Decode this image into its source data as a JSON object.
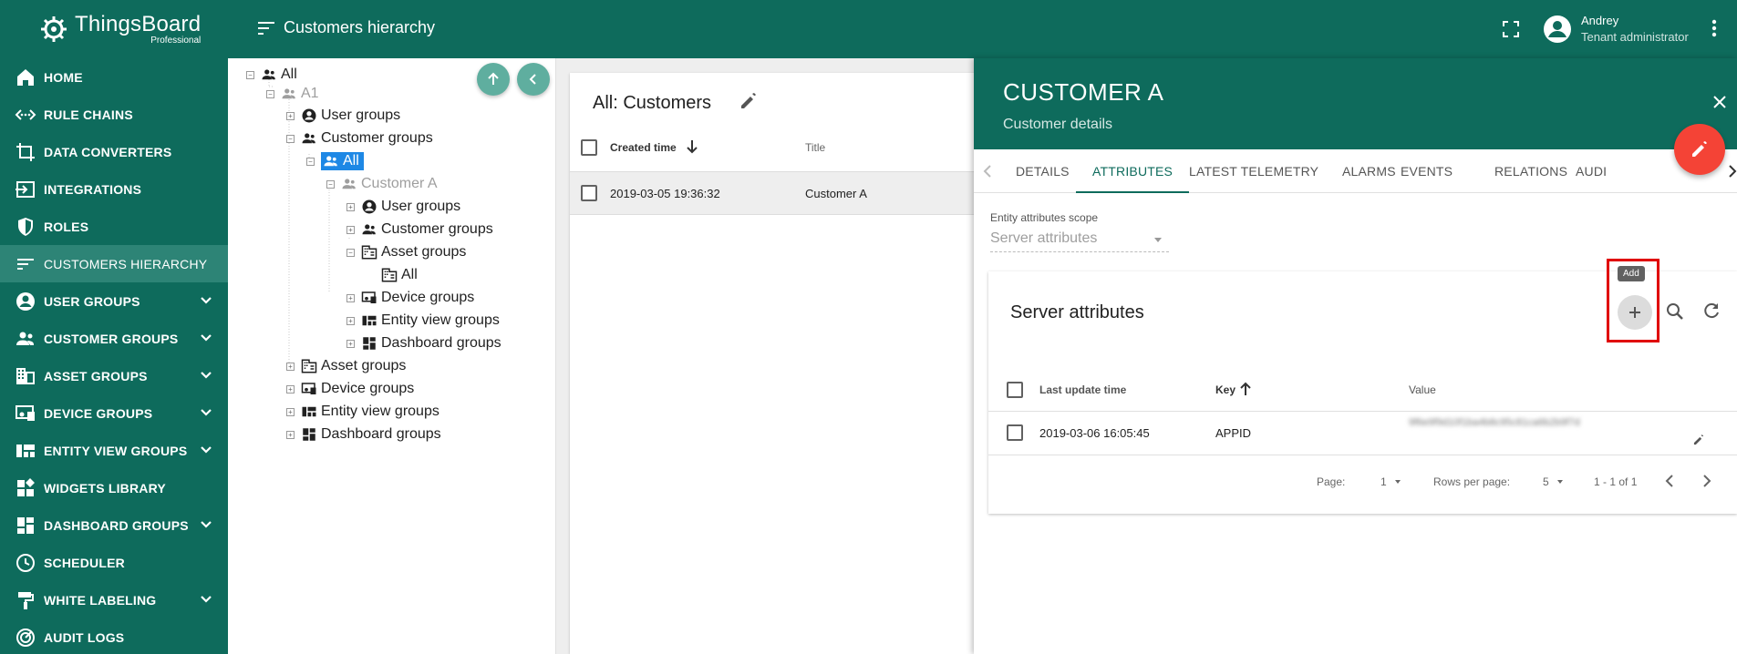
{
  "brand": {
    "name": "ThingsBoard",
    "edition": "Professional"
  },
  "colors": {
    "primary": "#0e6b5c",
    "accent": "#f44336",
    "selection": "#1e88e5",
    "highlight": "#e00000"
  },
  "sidebar": {
    "items": [
      {
        "label": "HOME",
        "icon": "home-icon"
      },
      {
        "label": "RULE CHAINS",
        "icon": "settings-ethernet-icon"
      },
      {
        "label": "DATA CONVERTERS",
        "icon": "transform-icon"
      },
      {
        "label": "INTEGRATIONS",
        "icon": "input-icon"
      },
      {
        "label": "ROLES",
        "icon": "security-icon"
      },
      {
        "label": "CUSTOMERS HIERARCHY",
        "icon": "sort-icon",
        "active": true
      },
      {
        "label": "USER GROUPS",
        "icon": "account-circle-icon",
        "expandable": true
      },
      {
        "label": "CUSTOMER GROUPS",
        "icon": "supervisor-account-icon",
        "expandable": true
      },
      {
        "label": "ASSET GROUPS",
        "icon": "domain-icon",
        "expandable": true
      },
      {
        "label": "DEVICE GROUPS",
        "icon": "devices-other-icon",
        "expandable": true
      },
      {
        "label": "ENTITY VIEW GROUPS",
        "icon": "view-quilt-icon",
        "expandable": true
      },
      {
        "label": "WIDGETS LIBRARY",
        "icon": "widgets-icon"
      },
      {
        "label": "DASHBOARD GROUPS",
        "icon": "dashboard-icon",
        "expandable": true
      },
      {
        "label": "SCHEDULER",
        "icon": "schedule-icon"
      },
      {
        "label": "WHITE LABELING",
        "icon": "format-paint-icon",
        "expandable": true
      },
      {
        "label": "AUDIT LOGS",
        "icon": "track-changes-icon"
      }
    ]
  },
  "topbar": {
    "title": "Customers hierarchy",
    "user_name": "Andrey",
    "user_role": "Tenant administrator"
  },
  "tree": {
    "nodes": [
      {
        "label": "All"
      },
      {
        "label": "A1"
      },
      {
        "label": "User groups"
      },
      {
        "label": "Customer groups"
      },
      {
        "label": "All"
      },
      {
        "label": "Customer A"
      },
      {
        "label": "User groups"
      },
      {
        "label": "Customer groups"
      },
      {
        "label": "Asset groups"
      },
      {
        "label": "All"
      },
      {
        "label": "Device groups"
      },
      {
        "label": "Entity view groups"
      },
      {
        "label": "Dashboard groups"
      },
      {
        "label": "Asset groups"
      },
      {
        "label": "Device groups"
      },
      {
        "label": "Entity view groups"
      },
      {
        "label": "Dashboard groups"
      }
    ]
  },
  "customers": {
    "title": "All: Customers",
    "columns": {
      "created": "Created time",
      "title": "Title"
    },
    "rows": [
      {
        "created": "2019-03-05 19:36:32",
        "title": "Customer A"
      }
    ]
  },
  "details": {
    "title": "CUSTOMER A",
    "subtitle": "Customer details",
    "tabs": [
      "DETAILS",
      "ATTRIBUTES",
      "LATEST TELEMETRY",
      "ALARMS",
      "EVENTS",
      "RELATIONS",
      "AUDI"
    ],
    "active_tab": "ATTRIBUTES",
    "scope_label": "Entity attributes scope",
    "scope_value": "Server attributes",
    "attributes": {
      "title": "Server attributes",
      "add_tooltip": "Add",
      "columns": {
        "last_update": "Last update time",
        "key": "Key",
        "value": "Value"
      },
      "rows": [
        {
          "last_update": "2019-03-06 16:05:45",
          "key": "APPID",
          "value": "9f6e9f9d10f1ba4b8c95c81ca6b2b9f7d"
        }
      ],
      "pager": {
        "page_label": "Page:",
        "page": "1",
        "rows_label": "Rows per page:",
        "rows": "5",
        "range": "1 - 1 of 1"
      }
    }
  }
}
